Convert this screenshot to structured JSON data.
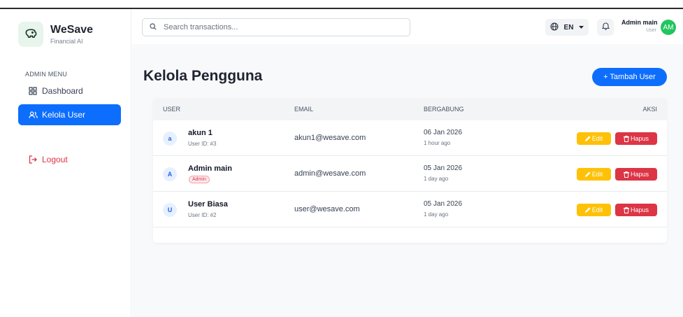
{
  "brand": {
    "name": "WeSave",
    "subtitle": "Financial AI"
  },
  "sidebar": {
    "menu_header": "ADMIN MENU",
    "items": [
      {
        "label": "Dashboard",
        "icon": "dashboard-grid-icon",
        "active": false
      },
      {
        "label": "Kelola User",
        "icon": "users-icon",
        "active": true
      }
    ],
    "logout_label": "Logout"
  },
  "topbar": {
    "search_placeholder": "Search transactions...",
    "language": "EN",
    "user_name": "Admin main",
    "user_role": "User",
    "avatar_initials": "AM"
  },
  "main": {
    "title": "Kelola Pengguna",
    "add_button_label": "+ Tambah User",
    "table": {
      "headers": {
        "user": "USER",
        "email": "EMAIL",
        "joined": "BERGABUNG",
        "actions": "AKSI"
      },
      "rows": [
        {
          "initial": "a",
          "name": "akun 1",
          "sub": "User ID: #3",
          "email": "akun1@wesave.com",
          "date": "06 Jan 2026",
          "ago": "1 hour ago"
        },
        {
          "initial": "A",
          "name": "Admin main",
          "badge": "Admin",
          "email": "admin@wesave.com",
          "date": "05 Jan 2026",
          "ago": "1 day ago"
        },
        {
          "initial": "U",
          "name": "User Biasa",
          "sub": "User ID: #2",
          "email": "user@wesave.com",
          "date": "05 Jan 2026",
          "ago": "1 day ago"
        }
      ],
      "edit_label": "Edit",
      "delete_label": "Hapus"
    }
  },
  "colors": {
    "primary": "#0d6efd",
    "warning": "#ffc107",
    "danger": "#dc3545",
    "avatar": "#22c55e"
  }
}
